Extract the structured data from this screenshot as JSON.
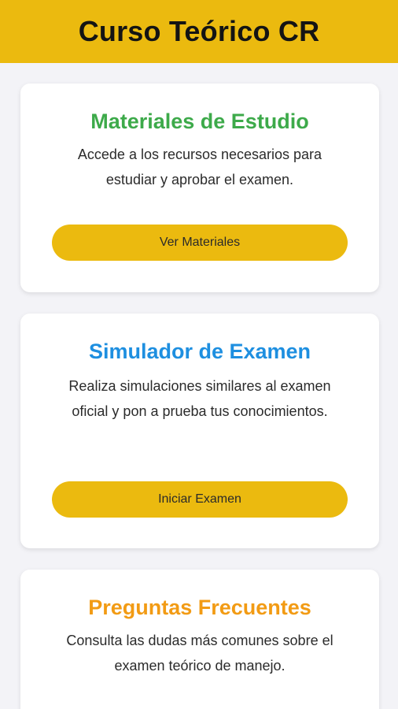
{
  "header": {
    "title": "Curso Teórico CR"
  },
  "cards": [
    {
      "title": "Materiales de Estudio",
      "title_color": "#3daa4a",
      "description": "Accede a los recursos necesarios para estudiar y aprobar el examen.",
      "button_label": "Ver Materiales"
    },
    {
      "title": "Simulador de Examen",
      "title_color": "#1e8fe0",
      "description": "Realiza simulaciones similares al examen oficial y pon a prueba tus conocimientos.",
      "button_label": "Iniciar Examen"
    },
    {
      "title": "Preguntas Frecuentes",
      "title_color": "#f29b14",
      "description": "Consulta las dudas más comunes sobre el examen teórico de manejo."
    }
  ],
  "colors": {
    "accent": "#ebba0f",
    "background": "#f3f3f7"
  }
}
